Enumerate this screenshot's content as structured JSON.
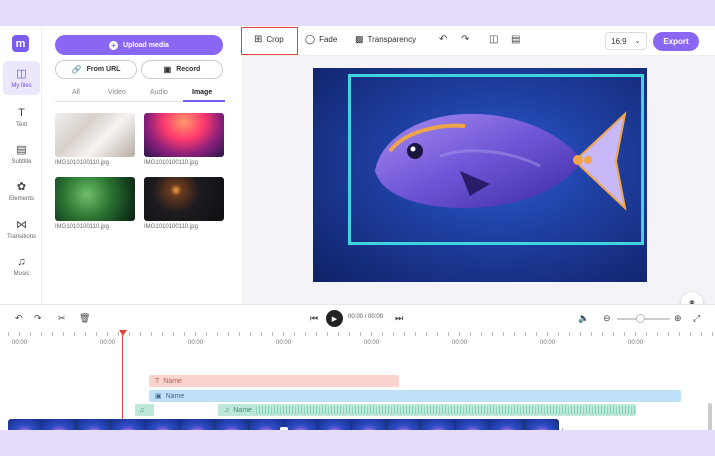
{
  "nav": {
    "logo": "m",
    "items": [
      {
        "label": "My files",
        "icon": "my-files-icon"
      },
      {
        "label": "Text",
        "icon": "text-icon"
      },
      {
        "label": "Subtitle",
        "icon": "subtitle-icon"
      },
      {
        "label": "Elements",
        "icon": "elements-icon"
      },
      {
        "label": "Transitions",
        "icon": "transitions-icon"
      },
      {
        "label": "Music",
        "icon": "music-icon"
      }
    ]
  },
  "panel": {
    "upload_label": "Upload media",
    "from_url_label": "From URL",
    "record_label": "Record",
    "tabs": [
      "All",
      "Video",
      "Audio",
      "Image"
    ],
    "active_tab": "Image",
    "thumbnails": [
      {
        "caption": "IMG1010100110.jpg"
      },
      {
        "caption": "IMG1010100110.jpg"
      },
      {
        "caption": "IMG1010100110.jpg"
      },
      {
        "caption": "IMG1010100110.jpg"
      }
    ]
  },
  "toolbar": {
    "crop_label": "Crop",
    "fade_label": "Fade",
    "transparency_label": "Transparency",
    "ratio_value": "16:9",
    "export_label": "Export"
  },
  "timeline": {
    "time_display": "00:00 / 00:00",
    "ruler_labels": [
      "00:00",
      "00:00",
      "00:00",
      "00:00",
      "00:00",
      "00:00",
      "00:00",
      "00:00"
    ],
    "tracks": {
      "text_name": "Name",
      "image_name": "Name",
      "audio_name": "Name"
    },
    "video_frame_count": 16
  },
  "colors": {
    "accent": "#8a67f3",
    "crop_highlight": "#e8443c",
    "crop_frame": "#3ed4e0"
  }
}
